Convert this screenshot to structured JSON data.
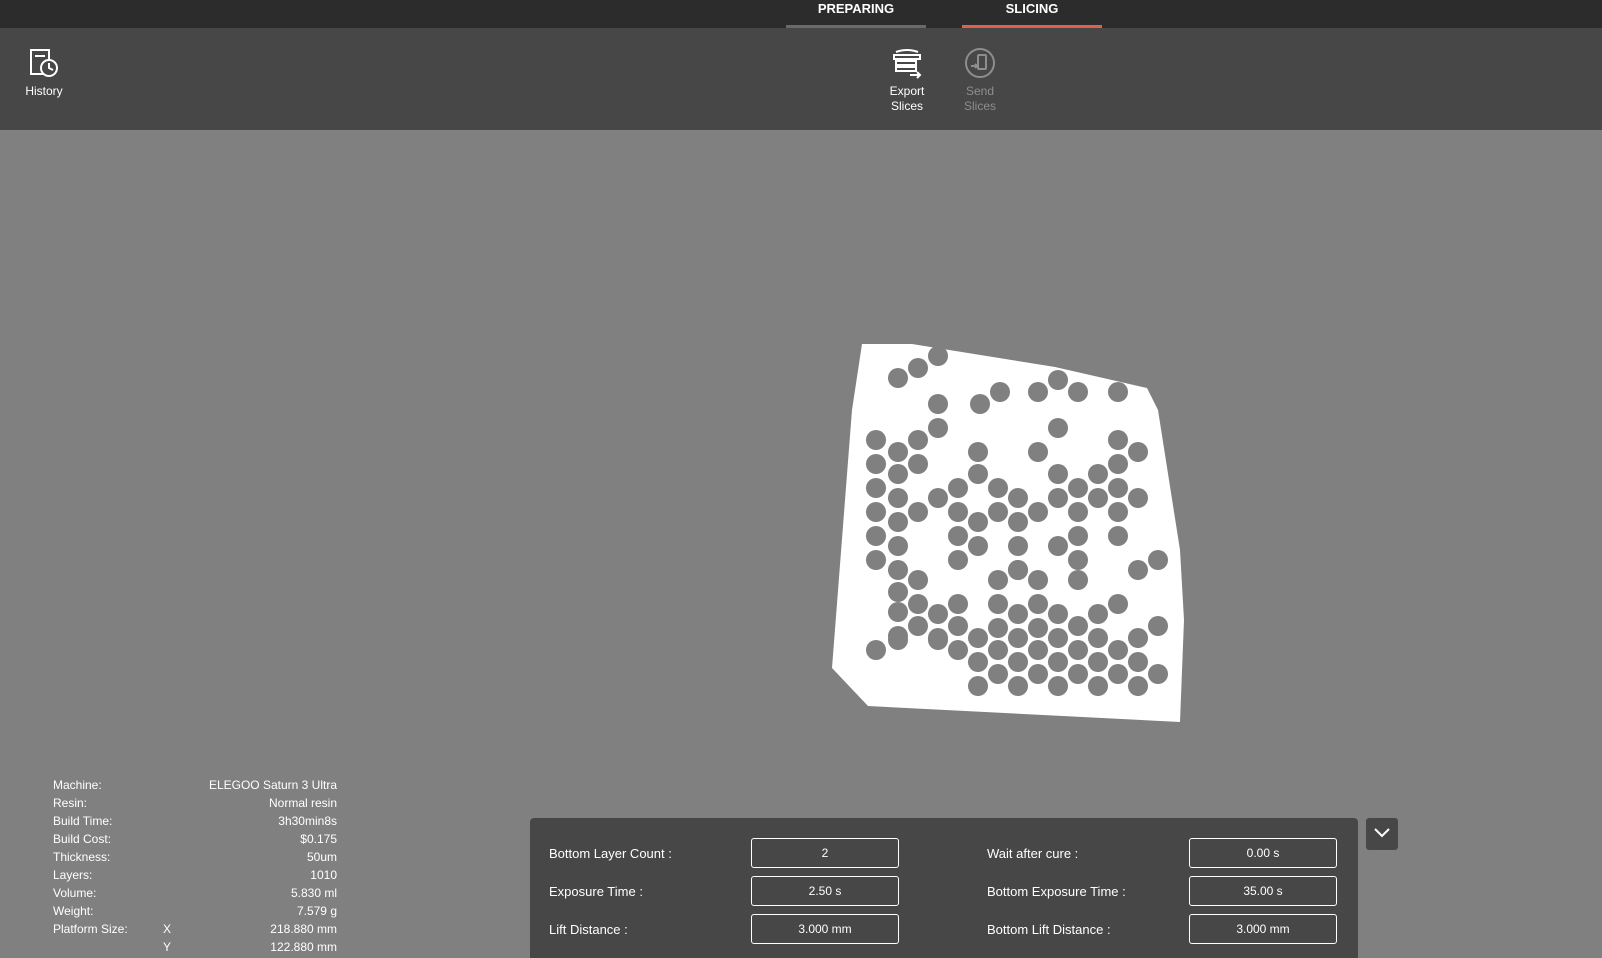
{
  "tabs": [
    {
      "label": "PREPARING"
    },
    {
      "label": "SLICING"
    }
  ],
  "toolbar": {
    "history": {
      "label": "History",
      "icon": "history-icon"
    },
    "export": {
      "label": "Export\nSlices",
      "icon": "export-slices-icon"
    },
    "send": {
      "label": "Send\nSlices",
      "icon": "send-slices-icon"
    }
  },
  "info": {
    "machine": {
      "key": "Machine:",
      "value": "ELEGOO Saturn 3 Ultra"
    },
    "resin": {
      "key": "Resin:",
      "value": "Normal resin"
    },
    "build_time": {
      "key": "Build Time:",
      "value": "3h30min8s"
    },
    "build_cost": {
      "key": "Build Cost:",
      "value": "$0.175"
    },
    "thickness": {
      "key": "Thickness:",
      "value": "50um"
    },
    "layers": {
      "key": "Layers:",
      "value": "1010"
    },
    "volume": {
      "key": "Volume:",
      "value": "5.830 ml"
    },
    "weight": {
      "key": "Weight:",
      "value": "7.579 g"
    },
    "platform": {
      "key": "Platform Size:",
      "x_axis": "X",
      "x_value": "218.880 mm",
      "y_axis": "Y",
      "y_value": "122.880 mm"
    }
  },
  "params": {
    "bottom_layer_count": {
      "label": "Bottom Layer Count :",
      "value": "2"
    },
    "wait_after_cure": {
      "label": "Wait after cure :",
      "value": "0.00 s"
    },
    "exposure_time": {
      "label": "Exposure Time :",
      "value": "2.50 s"
    },
    "bottom_exposure_time": {
      "label": "Bottom Exposure Time :",
      "value": "35.00 s"
    },
    "lift_distance": {
      "label": "Lift Distance :",
      "value": "3.000 mm"
    },
    "bottom_lift_distance": {
      "label": "Bottom Lift Distance :",
      "value": "3.000 mm"
    }
  },
  "colors": {
    "accent": "#e0604f",
    "background": "#808080",
    "panel": "#474747",
    "topbar": "#2c2c2c",
    "slice": "#ffffff"
  }
}
